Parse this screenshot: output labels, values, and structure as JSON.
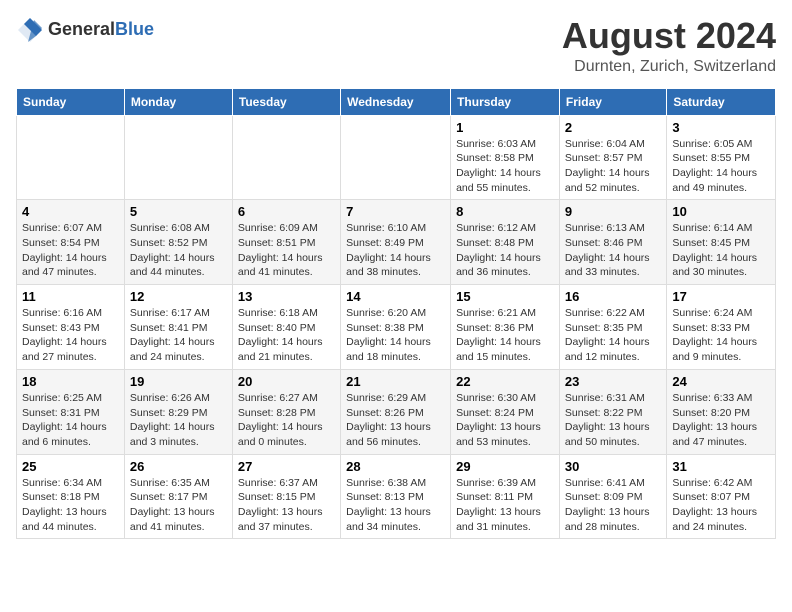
{
  "header": {
    "logo_general": "General",
    "logo_blue": "Blue",
    "title": "August 2024",
    "subtitle": "Durnten, Zurich, Switzerland"
  },
  "days_of_week": [
    "Sunday",
    "Monday",
    "Tuesday",
    "Wednesday",
    "Thursday",
    "Friday",
    "Saturday"
  ],
  "weeks": [
    [
      {
        "day": "",
        "info": ""
      },
      {
        "day": "",
        "info": ""
      },
      {
        "day": "",
        "info": ""
      },
      {
        "day": "",
        "info": ""
      },
      {
        "day": "1",
        "info": "Sunrise: 6:03 AM\nSunset: 8:58 PM\nDaylight: 14 hours\nand 55 minutes."
      },
      {
        "day": "2",
        "info": "Sunrise: 6:04 AM\nSunset: 8:57 PM\nDaylight: 14 hours\nand 52 minutes."
      },
      {
        "day": "3",
        "info": "Sunrise: 6:05 AM\nSunset: 8:55 PM\nDaylight: 14 hours\nand 49 minutes."
      }
    ],
    [
      {
        "day": "4",
        "info": "Sunrise: 6:07 AM\nSunset: 8:54 PM\nDaylight: 14 hours\nand 47 minutes."
      },
      {
        "day": "5",
        "info": "Sunrise: 6:08 AM\nSunset: 8:52 PM\nDaylight: 14 hours\nand 44 minutes."
      },
      {
        "day": "6",
        "info": "Sunrise: 6:09 AM\nSunset: 8:51 PM\nDaylight: 14 hours\nand 41 minutes."
      },
      {
        "day": "7",
        "info": "Sunrise: 6:10 AM\nSunset: 8:49 PM\nDaylight: 14 hours\nand 38 minutes."
      },
      {
        "day": "8",
        "info": "Sunrise: 6:12 AM\nSunset: 8:48 PM\nDaylight: 14 hours\nand 36 minutes."
      },
      {
        "day": "9",
        "info": "Sunrise: 6:13 AM\nSunset: 8:46 PM\nDaylight: 14 hours\nand 33 minutes."
      },
      {
        "day": "10",
        "info": "Sunrise: 6:14 AM\nSunset: 8:45 PM\nDaylight: 14 hours\nand 30 minutes."
      }
    ],
    [
      {
        "day": "11",
        "info": "Sunrise: 6:16 AM\nSunset: 8:43 PM\nDaylight: 14 hours\nand 27 minutes."
      },
      {
        "day": "12",
        "info": "Sunrise: 6:17 AM\nSunset: 8:41 PM\nDaylight: 14 hours\nand 24 minutes."
      },
      {
        "day": "13",
        "info": "Sunrise: 6:18 AM\nSunset: 8:40 PM\nDaylight: 14 hours\nand 21 minutes."
      },
      {
        "day": "14",
        "info": "Sunrise: 6:20 AM\nSunset: 8:38 PM\nDaylight: 14 hours\nand 18 minutes."
      },
      {
        "day": "15",
        "info": "Sunrise: 6:21 AM\nSunset: 8:36 PM\nDaylight: 14 hours\nand 15 minutes."
      },
      {
        "day": "16",
        "info": "Sunrise: 6:22 AM\nSunset: 8:35 PM\nDaylight: 14 hours\nand 12 minutes."
      },
      {
        "day": "17",
        "info": "Sunrise: 6:24 AM\nSunset: 8:33 PM\nDaylight: 14 hours\nand 9 minutes."
      }
    ],
    [
      {
        "day": "18",
        "info": "Sunrise: 6:25 AM\nSunset: 8:31 PM\nDaylight: 14 hours\nand 6 minutes."
      },
      {
        "day": "19",
        "info": "Sunrise: 6:26 AM\nSunset: 8:29 PM\nDaylight: 14 hours\nand 3 minutes."
      },
      {
        "day": "20",
        "info": "Sunrise: 6:27 AM\nSunset: 8:28 PM\nDaylight: 14 hours\nand 0 minutes."
      },
      {
        "day": "21",
        "info": "Sunrise: 6:29 AM\nSunset: 8:26 PM\nDaylight: 13 hours\nand 56 minutes."
      },
      {
        "day": "22",
        "info": "Sunrise: 6:30 AM\nSunset: 8:24 PM\nDaylight: 13 hours\nand 53 minutes."
      },
      {
        "day": "23",
        "info": "Sunrise: 6:31 AM\nSunset: 8:22 PM\nDaylight: 13 hours\nand 50 minutes."
      },
      {
        "day": "24",
        "info": "Sunrise: 6:33 AM\nSunset: 8:20 PM\nDaylight: 13 hours\nand 47 minutes."
      }
    ],
    [
      {
        "day": "25",
        "info": "Sunrise: 6:34 AM\nSunset: 8:18 PM\nDaylight: 13 hours\nand 44 minutes."
      },
      {
        "day": "26",
        "info": "Sunrise: 6:35 AM\nSunset: 8:17 PM\nDaylight: 13 hours\nand 41 minutes."
      },
      {
        "day": "27",
        "info": "Sunrise: 6:37 AM\nSunset: 8:15 PM\nDaylight: 13 hours\nand 37 minutes."
      },
      {
        "day": "28",
        "info": "Sunrise: 6:38 AM\nSunset: 8:13 PM\nDaylight: 13 hours\nand 34 minutes."
      },
      {
        "day": "29",
        "info": "Sunrise: 6:39 AM\nSunset: 8:11 PM\nDaylight: 13 hours\nand 31 minutes."
      },
      {
        "day": "30",
        "info": "Sunrise: 6:41 AM\nSunset: 8:09 PM\nDaylight: 13 hours\nand 28 minutes."
      },
      {
        "day": "31",
        "info": "Sunrise: 6:42 AM\nSunset: 8:07 PM\nDaylight: 13 hours\nand 24 minutes."
      }
    ]
  ]
}
